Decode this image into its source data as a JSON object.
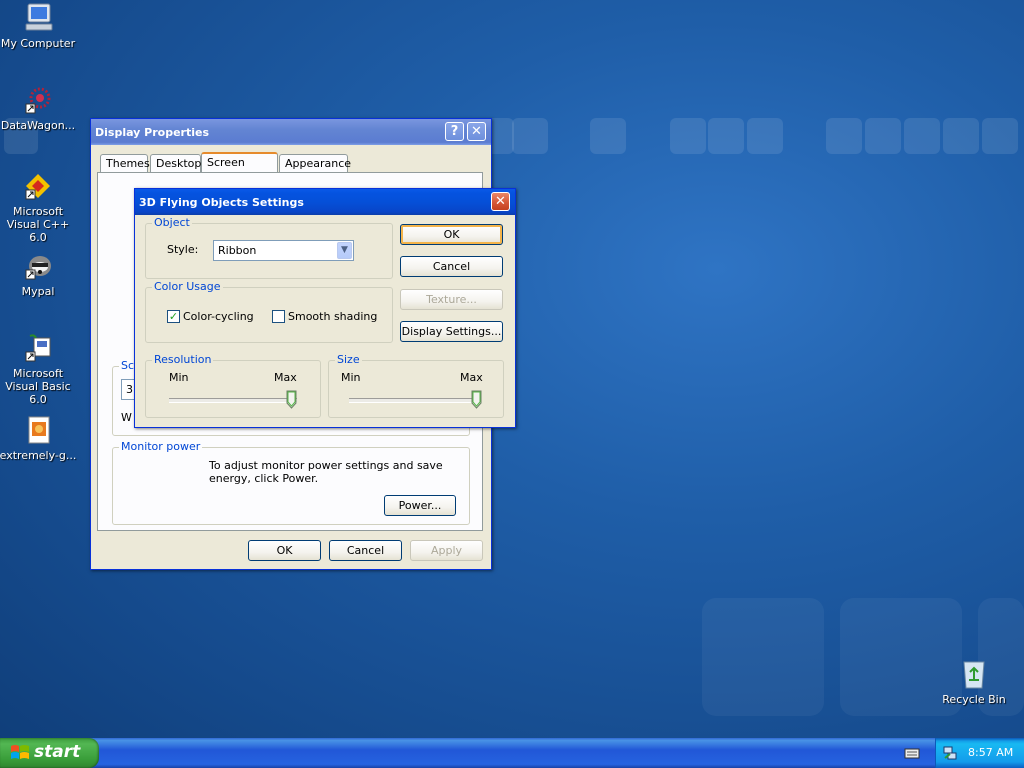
{
  "desktop": {
    "icons": [
      {
        "label": "My Computer",
        "icon": "computer-icon"
      },
      {
        "label": "DataWagon...",
        "icon": "shortcut-app-icon"
      },
      {
        "label": "Microsoft Visual C++ 6.0",
        "icon": "visual-cpp-icon"
      },
      {
        "label": "Mypal",
        "icon": "mypal-icon"
      },
      {
        "label": "Microsoft Visual Basic 6.0",
        "icon": "visual-basic-icon"
      },
      {
        "label": "extremely-g...",
        "icon": "image-file-icon"
      },
      {
        "label": "Recycle Bin",
        "icon": "recycle-bin-icon"
      }
    ]
  },
  "display_properties": {
    "title": "Display Properties",
    "help_glyph": "?",
    "close_glyph": "✕",
    "tabs": [
      {
        "label": "Themes"
      },
      {
        "label": "Desktop"
      },
      {
        "label": "Screen Saver"
      },
      {
        "label": "Appearance"
      }
    ],
    "selected_tab": "Screen Saver",
    "screen_saver_partial": {
      "group_label_fragment": "Sc",
      "combo_fragment": "3D",
      "wait_fragment": "W"
    },
    "monitor_power": {
      "label": "Monitor power",
      "text": "To adjust monitor power settings and save energy, click Power.",
      "power_button": "Power..."
    },
    "buttons": {
      "ok": "OK",
      "cancel": "Cancel",
      "apply": "Apply"
    }
  },
  "settings_dialog": {
    "title": "3D Flying Objects Settings",
    "close_glyph": "✕",
    "object": {
      "label": "Object",
      "style_label": "Style:",
      "style_value": "Ribbon"
    },
    "color_usage": {
      "label": "Color Usage",
      "color_cycling": {
        "label": "Color-cycling",
        "checked": true
      },
      "smooth_shading": {
        "label": "Smooth shading",
        "checked": false
      }
    },
    "resolution": {
      "label": "Resolution",
      "min": "Min",
      "max": "Max",
      "level": 1.0
    },
    "size": {
      "label": "Size",
      "min": "Min",
      "max": "Max",
      "level": 1.0
    },
    "buttons": {
      "ok": "OK",
      "cancel": "Cancel",
      "texture": "Texture...",
      "display_settings": "Display Settings..."
    }
  },
  "taskbar": {
    "start_label": "start",
    "clock": "8:57 AM",
    "tray_icons": [
      "keyboard-icon",
      "network-icon"
    ]
  }
}
